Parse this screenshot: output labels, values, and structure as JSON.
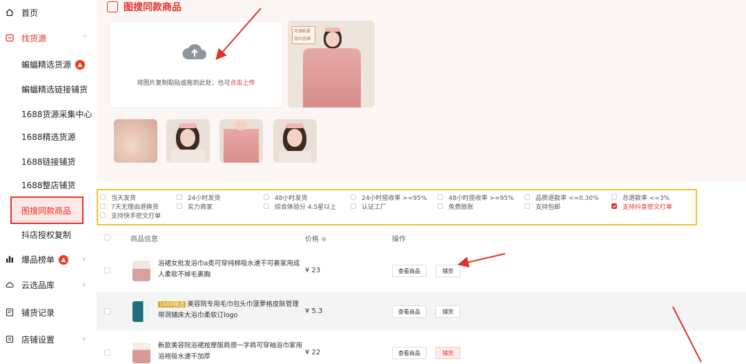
{
  "sidebar": {
    "items": [
      {
        "label": "首页",
        "icon": "home-icon"
      },
      {
        "label": "找货源",
        "icon": "sourcing-icon"
      },
      {
        "label": "爆品榜单",
        "icon": "ranking-icon"
      },
      {
        "label": "云选品库",
        "icon": "cloud-library-icon"
      },
      {
        "label": "铺货记录",
        "icon": "record-icon"
      },
      {
        "label": "店铺设置",
        "icon": "shop-settings-icon"
      }
    ],
    "sub_items": [
      {
        "label": "蝙蝠精选货源"
      },
      {
        "label": "蝙蝠精选链接铺货"
      },
      {
        "label": "1688货源采集中心"
      },
      {
        "label": "1688精选货源"
      },
      {
        "label": "1688链接铺货"
      },
      {
        "label": "1688整店铺货"
      },
      {
        "label": "图搜同款商品"
      },
      {
        "label": "抖店授权复制"
      }
    ]
  },
  "upload": {
    "title": "图搜同款商品",
    "drop_text": "将图片复制黏贴或拖到此处，也可",
    "drop_link": "点击上传",
    "photo_tag": "可调松紧 浴巾浴裙"
  },
  "filters": [
    {
      "label": "当天发货",
      "checked": false
    },
    {
      "label": "24小时发货",
      "checked": false
    },
    {
      "label": "48小时发货",
      "checked": false
    },
    {
      "label": "24小时揽收率 >=95%",
      "checked": false
    },
    {
      "label": "48小时揽收率 >=95%",
      "checked": false
    },
    {
      "label": "品质退款率 <=0.30%",
      "checked": false
    },
    {
      "label": "总退款率 <=3%",
      "checked": false
    },
    {
      "label": "7天无理由退换货",
      "checked": false
    },
    {
      "label": "实力商家",
      "checked": false
    },
    {
      "label": "综合体验分 4.5星以上",
      "checked": false
    },
    {
      "label": "认证工厂",
      "checked": false
    },
    {
      "label": "免费赊账",
      "checked": false
    },
    {
      "label": "支持包邮",
      "checked": false
    },
    {
      "label": "支持抖音密文打单",
      "checked": true
    },
    {
      "label": "支持快手密文打单",
      "checked": false
    }
  ],
  "table": {
    "headers": {
      "info": "商品信息",
      "price": "价格 ≑",
      "actions": "操作"
    },
    "rows": [
      {
        "badge": "",
        "title": "浴裙女批发浴巾a类可穿纯棉吸水速干可裹家用成人柔软不掉毛裹胸",
        "price": "¥ 23",
        "view": "查看商品",
        "stock": "铺货",
        "stock_highlight": false
      },
      {
        "badge": "1688精选",
        "title": "美容院专用毛巾包头巾菠萝格皮肤管理带洞铺床大浴巾柔软订logo",
        "price": "¥ 5.3",
        "view": "查看商品",
        "stock": "铺货",
        "stock_highlight": false
      },
      {
        "badge": "",
        "title": "新款美容院浴裙按摩服肩颈一字肩可穿袖浴巾家用浴袍吸水速干加厚",
        "price": "¥ 22",
        "view": "查看商品",
        "stock": "铺货",
        "stock_highlight": true
      }
    ]
  },
  "colors": {
    "accent": "#e5302a",
    "filter_border": "#f2c22e",
    "panel_bg": "#fbf6f3"
  }
}
